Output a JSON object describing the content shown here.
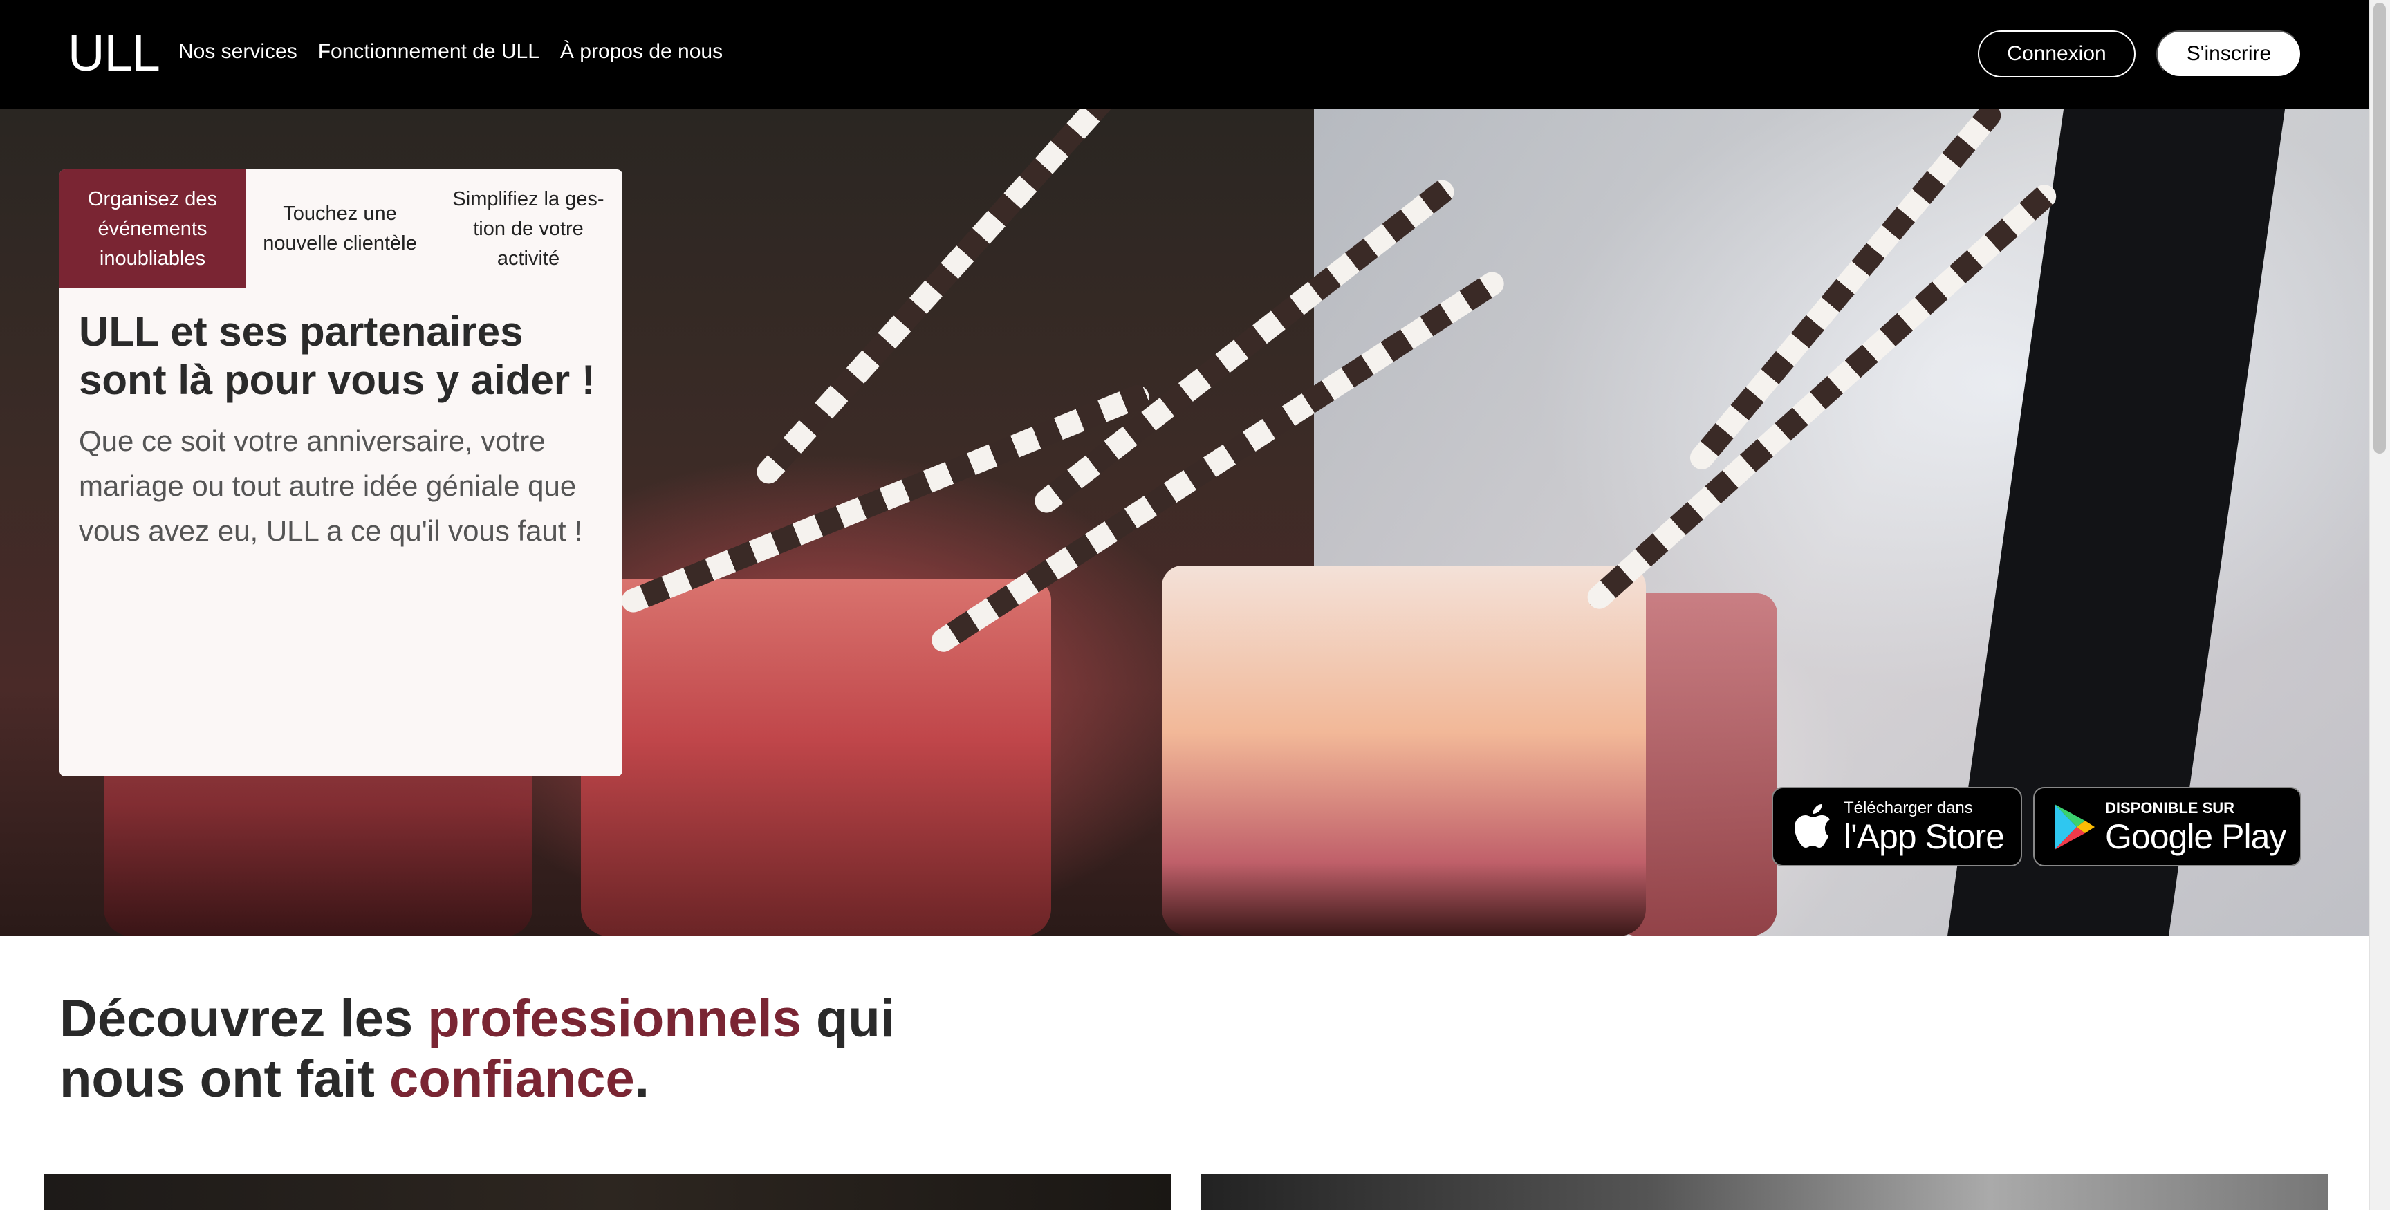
{
  "brand": {
    "logo": "ULL"
  },
  "nav": {
    "links": [
      "Nos services",
      "Fonctionnement de ULL",
      "À propos de nous"
    ],
    "login": "Connexion",
    "signup": "S'inscrire"
  },
  "hero": {
    "tabs": [
      "Organisez des événements inoubliables",
      "Touchez une nouvelle clientèle",
      "Simplifiez la ges-tion de votre activité"
    ],
    "active_tab": 0,
    "title": "ULL et ses partenaires sont là pour vous y aider !",
    "text": "Que ce soit votre anniversaire, votre mariage ou tout autre idée géniale que vous avez eu, ULL a ce qu'il vous faut !"
  },
  "badges": {
    "apple_small": "Télécharger dans",
    "apple_big": "l'App Store",
    "google_small": "DISPONIBLE SUR",
    "google_big": "Google Play"
  },
  "section": {
    "title_part1": "Découvrez les ",
    "title_accent1": "professionnels",
    "title_part2": " qui nous ont fait ",
    "title_accent2": "confiance",
    "title_part3": "."
  },
  "colors": {
    "accent": "#7a2533",
    "nav_bg": "#000000"
  }
}
